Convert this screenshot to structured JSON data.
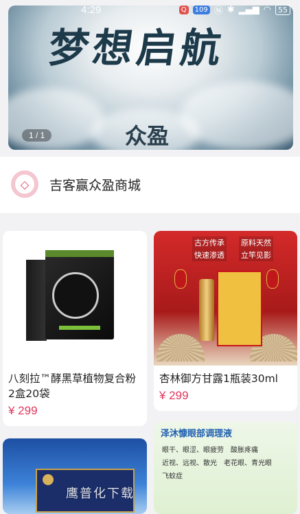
{
  "status_bar": {
    "time": "4:29",
    "badges": [
      "Q",
      "109"
    ],
    "battery": "55"
  },
  "banner": {
    "title": "梦想启航",
    "brand": "众盈",
    "pager": "1 / 1"
  },
  "mall": {
    "name": "吉客赢众盈商城",
    "icon": "diamond-icon"
  },
  "products": [
    {
      "name_line1": "八刻拉™酵黑草植物复合粉",
      "name_line2": "2盒20袋",
      "price": "¥ 299"
    },
    {
      "name_line1": "杏林御方甘露1瓶装30ml",
      "price": "¥ 299",
      "badges": [
        "古方传承",
        "原料天然",
        "快速渗透",
        "立竿见影"
      ]
    },
    {
      "name_line1": ""
    },
    {
      "name_line1": "",
      "headline": "泽沐慷眼部调理液",
      "tags": [
        "眼干、眼涩、眼疲劳",
        "酸胀疼痛",
        "近视、远视、散光",
        "老花眼、青光眼",
        "飞蚊症"
      ]
    }
  ],
  "watermark": "鹰普化下载"
}
